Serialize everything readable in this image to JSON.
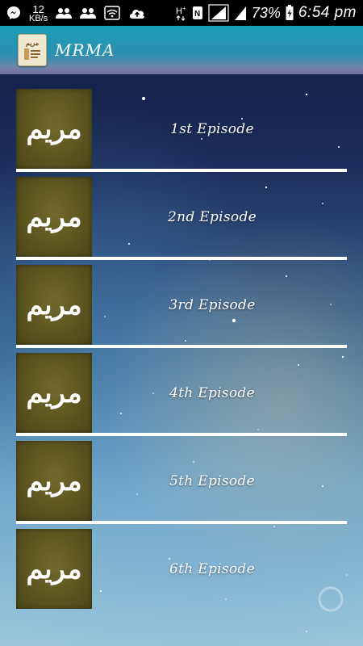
{
  "status_bar": {
    "speed_value": "12",
    "speed_unit": "KB/s",
    "battery_percent": "73%",
    "time": "6:54 pm",
    "left_icons": [
      "messenger-icon",
      "people-icon",
      "people-icon",
      "wifi-icon",
      "cloud-upload-icon"
    ],
    "right_icons": [
      "h-plus-icon",
      "data-arrows-icon",
      "nfc-icon",
      "signal-full-icon",
      "signal-full-icon",
      "battery-charging-icon"
    ]
  },
  "app_bar": {
    "title": "MRMA",
    "icon": "book-cover-icon",
    "icon_text": "مریم"
  },
  "episodes": [
    {
      "thumb_text": "مریم",
      "label": "1st Episode"
    },
    {
      "thumb_text": "مریم",
      "label": "2nd Episode"
    },
    {
      "thumb_text": "مریم",
      "label": "3rd Episode"
    },
    {
      "thumb_text": "مریم",
      "label": "4th Episode"
    },
    {
      "thumb_text": "مریم",
      "label": "5th Episode"
    },
    {
      "thumb_text": "مریم",
      "label": "6th Episode"
    }
  ],
  "colors": {
    "thumb_bg": "#5b5520",
    "divider": "#ffffff",
    "app_bar_top": "#1aa0b4"
  }
}
